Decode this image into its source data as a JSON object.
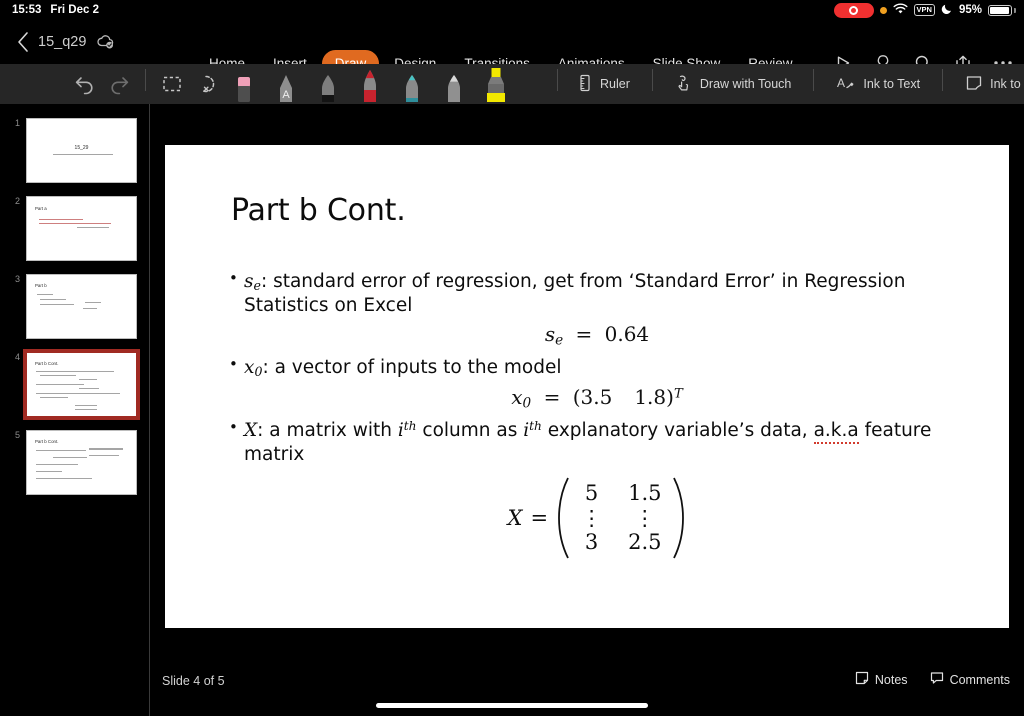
{
  "status_bar": {
    "time": "15:53",
    "date": "Fri Dec 2",
    "battery_percent": "95%",
    "vpn_label": "VPN",
    "icons": [
      "screen-recording-indicator",
      "orange-privacy-dot",
      "wifi-icon",
      "vpn-badge",
      "do-not-disturb-moon-icon",
      "battery-icon"
    ]
  },
  "title_bar": {
    "back_label": "‹",
    "document_name": "15_q29",
    "cloud_status_icon": "cloud-saved-icon"
  },
  "ribbon_tabs": [
    {
      "label": "Home",
      "active": false
    },
    {
      "label": "Insert",
      "active": false
    },
    {
      "label": "Draw",
      "active": true
    },
    {
      "label": "Design",
      "active": false
    },
    {
      "label": "Transitions",
      "active": false
    },
    {
      "label": "Animations",
      "active": false
    },
    {
      "label": "Slide Show",
      "active": false
    },
    {
      "label": "Review",
      "active": false
    }
  ],
  "top_actions": [
    {
      "name": "play-slideshow-icon"
    },
    {
      "name": "tell-me-lightbulb-icon"
    },
    {
      "name": "search-icon"
    },
    {
      "name": "share-icon"
    },
    {
      "name": "more-options-icon"
    }
  ],
  "draw_ribbon": {
    "undo_label": "Undo",
    "redo_label": "Redo",
    "tools": [
      {
        "name": "lasso-select-tool"
      },
      {
        "name": "ink-select-tool"
      },
      {
        "name": "eraser-tool",
        "color": "#f2a0b4"
      },
      {
        "name": "ink-to-text-pen-tool",
        "color": "#d9d9d9",
        "glyph": "A"
      },
      {
        "name": "black-pen-tool",
        "color": "#1a1a1a"
      },
      {
        "name": "red-pen-tool",
        "color": "#d32030",
        "selected": false
      },
      {
        "name": "teal-pen-tool",
        "color": "#3fb6b6"
      },
      {
        "name": "grey-pencil-tool",
        "color": "#c8c8c8"
      },
      {
        "name": "yellow-highlighter-tool",
        "color": "#f5f000",
        "selected": true
      }
    ],
    "items": [
      {
        "label": "Ruler",
        "icon": "ruler-icon"
      },
      {
        "label": "Draw with Touch",
        "icon": "draw-with-touch-icon"
      },
      {
        "label": "Ink to Text",
        "icon": "ink-to-text-icon"
      },
      {
        "label": "Ink to Shape",
        "icon": "ink-to-shape-icon"
      }
    ]
  },
  "thumbnails": [
    {
      "number": "1",
      "title": "15_29",
      "selected": false
    },
    {
      "number": "2",
      "title": "Part a",
      "selected": false
    },
    {
      "number": "3",
      "title": "Part b",
      "selected": false
    },
    {
      "number": "4",
      "title": "Part b Cont.",
      "selected": true
    },
    {
      "number": "5",
      "title": "Part b Cont.",
      "selected": false
    }
  ],
  "slide": {
    "title": "Part b Cont.",
    "bullets": [
      {
        "symbol": "s",
        "symbol_sub": "e",
        "text": ": standard error of regression, get from ‘Standard Error’ in Regression Statistics on Excel",
        "equation": "s_e = 0.64"
      },
      {
        "symbol": "x",
        "symbol_sub": "0",
        "text": ": a vector of inputs to the model",
        "equation": "x_0 = (3.5   1.8)^T"
      },
      {
        "symbol": "X",
        "symbol_sub": "",
        "text": ": a matrix with i^th column as i^th explanatory variable’s data, a.k.a feature matrix",
        "equation": "X = matrix"
      }
    ],
    "equation1": {
      "lhs": "s",
      "lhs_sub": "e",
      "op": "=",
      "rhs": "0.64"
    },
    "equation2": {
      "lhs": "x",
      "lhs_sub": "0",
      "op": "=",
      "v1": "3.5",
      "v2": "1.8",
      "transpose": "T"
    },
    "matrix": {
      "lhs": "X",
      "op": "=",
      "rows": [
        [
          "5",
          "1.5"
        ],
        [
          "⋮",
          "⋮"
        ],
        [
          "3",
          "2.5"
        ]
      ]
    },
    "spellcheck_word": "a.k.a"
  },
  "bottom_bar": {
    "slide_counter": "Slide 4 of 5",
    "notes_label": "Notes",
    "comments_label": "Comments"
  },
  "colors": {
    "accent_orange": "#e06a20",
    "selection_red": "#a02a22",
    "ribbon_bg": "#262626",
    "app_bg": "#000000"
  }
}
